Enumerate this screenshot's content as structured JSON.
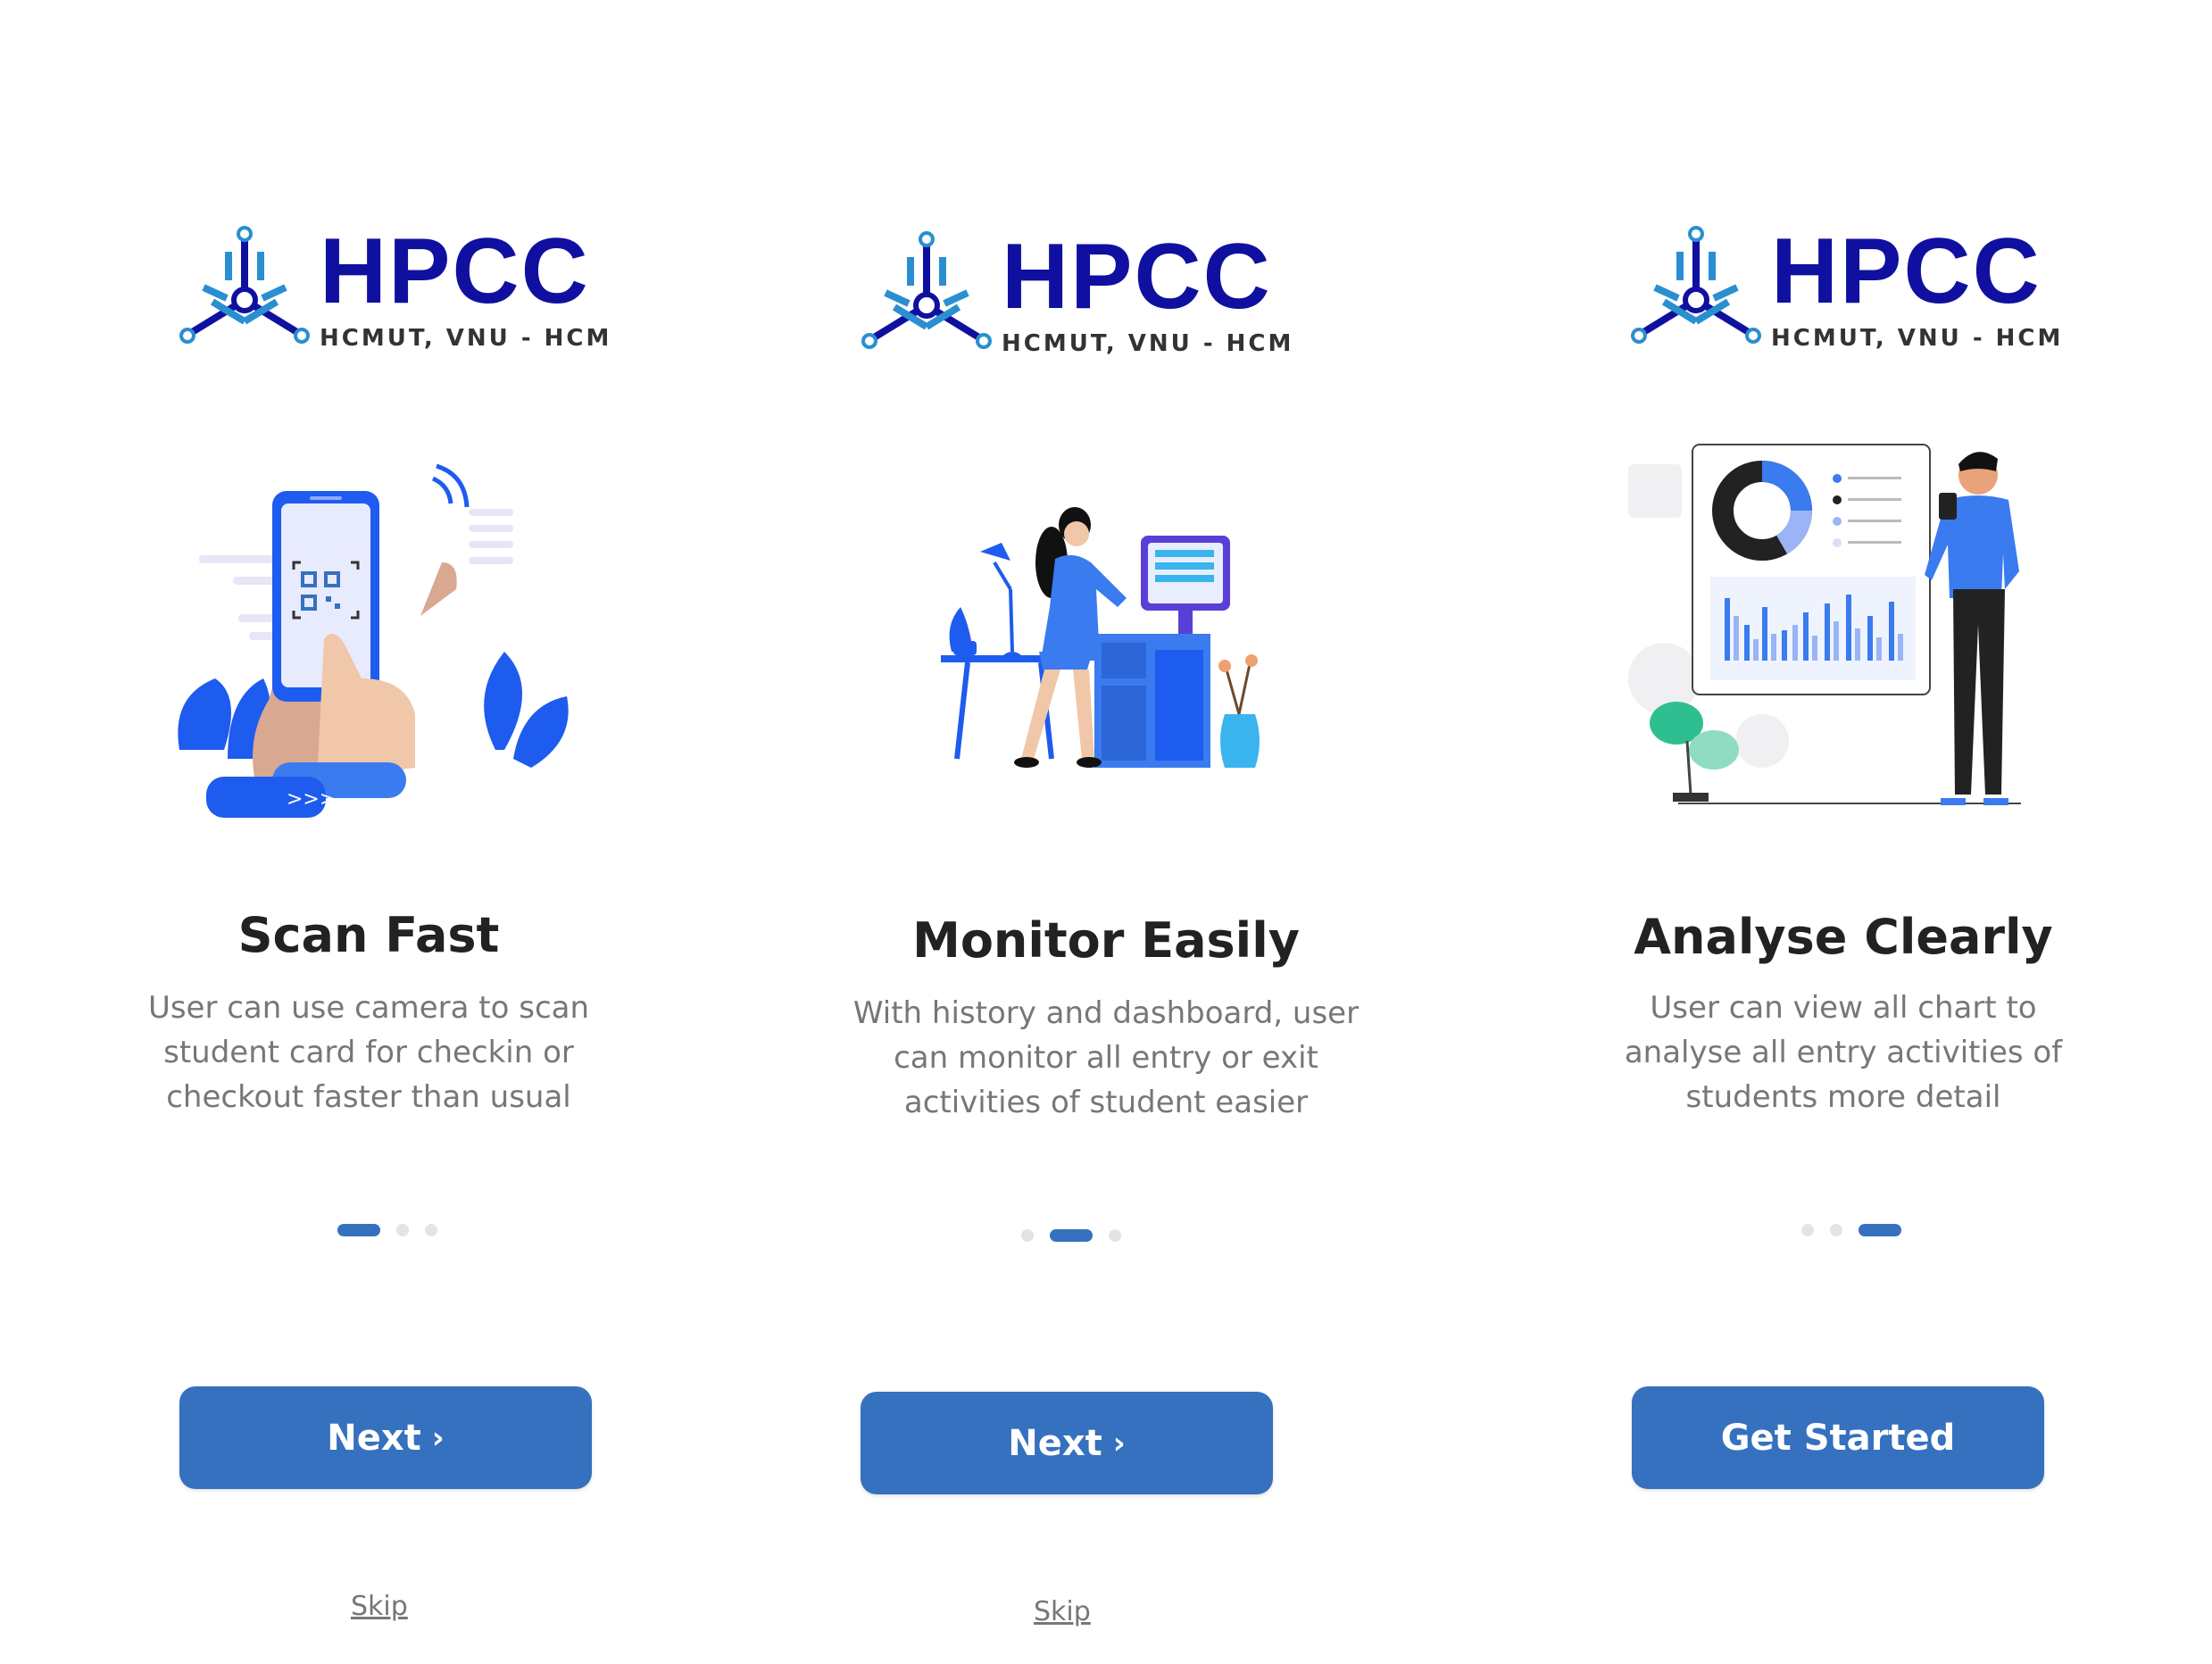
{
  "brand": {
    "name": "HPCC",
    "subtitle": "HCMUT, VNU - HCM",
    "colors": {
      "primary": "#1010a0",
      "accent": "#3571be",
      "light": "#2a8fd0"
    }
  },
  "screens": [
    {
      "title": "Scan Fast",
      "description": "User can use camera to scan student card for checkin or checkout faster than usual",
      "page_indicator": {
        "current": 1,
        "total": 3
      },
      "button_label": "Next",
      "button_icon": "chevron-right-icon",
      "skip_label": "Skip",
      "illustration": "phone-qr-scan-illustration"
    },
    {
      "title": "Monitor Easily",
      "description": "With history and dashboard, user can monitor all entry or exit activities of student easier",
      "page_indicator": {
        "current": 2,
        "total": 3
      },
      "button_label": "Next",
      "button_icon": "chevron-right-icon",
      "skip_label": "Skip",
      "illustration": "woman-at-computer-illustration"
    },
    {
      "title": "Analyse Clearly",
      "description": "User can view all chart to analyse all entry activities of students more detail",
      "page_indicator": {
        "current": 3,
        "total": 3
      },
      "button_label": "Get Started",
      "illustration": "man-with-dashboard-illustration"
    }
  ]
}
